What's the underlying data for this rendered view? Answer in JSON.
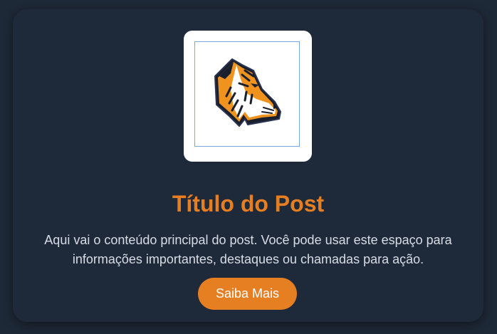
{
  "post": {
    "logo_icon": "tiger-head-icon",
    "title": "Título do Post",
    "content": "Aqui vai o conteúdo principal do post. Você pode usar este espaço para informações importantes, destaques ou chamadas para ação.",
    "button_label": "Saiba Mais"
  },
  "colors": {
    "page_background": "#1e2937",
    "card_background": "#1e2a3a",
    "accent": "#e67e22",
    "text": "#d8dde5"
  }
}
